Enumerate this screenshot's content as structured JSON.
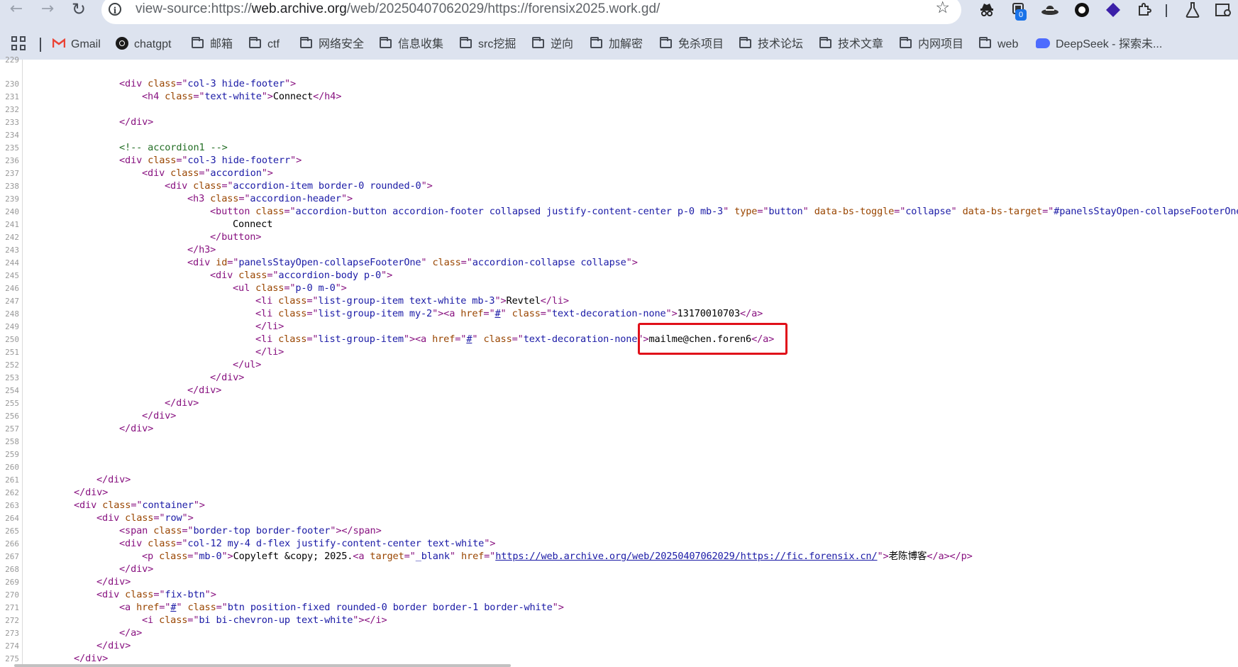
{
  "browser": {
    "url_prefix": "view-source:https://",
    "url_host": "web.archive.org",
    "url_path": "/web/20250407062029/https://forensix2025.work.gd/",
    "extension_badge": "0",
    "bookmarks": [
      "Gmail",
      "chatgpt",
      "邮箱",
      "ctf",
      "网络安全",
      "信息收集",
      "src挖掘",
      "逆向",
      "加解密",
      "免杀项目",
      "技术论坛",
      "技术文章",
      "内网项目",
      "web",
      "DeepSeek - 探索未..."
    ]
  },
  "source": {
    "line_numbers": [
      "229",
      "230",
      "231",
      "232",
      "233",
      "234",
      "235",
      "236",
      "237",
      "238",
      "239",
      "240",
      "241",
      "242",
      "243",
      "244",
      "245",
      "246",
      "247",
      "248",
      "249",
      "250",
      "251",
      "252",
      "253",
      "254",
      "255",
      "256",
      "257",
      "258",
      "259",
      "260",
      "261",
      "262",
      "263",
      "264",
      "265",
      "266",
      "267",
      "268",
      "269",
      "270",
      "271",
      "272",
      "273",
      "274",
      "275"
    ],
    "tokens": {
      "l230": [
        "<div ",
        "class",
        "=\"",
        "col-3 hide-footer",
        "\">"
      ],
      "l231": [
        "<h4 ",
        "class",
        "=\"",
        "text-white",
        "\">",
        "Connect",
        "</h4>"
      ],
      "l233": [
        "</div>"
      ],
      "l235": [
        "<!-- accordion1 -->"
      ],
      "l236": [
        "<div ",
        "class",
        "=\"",
        "col-3 hide-footerr",
        "\">"
      ],
      "l237": [
        "<div ",
        "class",
        "=\"",
        "accordion",
        "\">"
      ],
      "l238": [
        "<div ",
        "class",
        "=\"",
        "accordion-item border-0 rounded-0",
        "\">"
      ],
      "l239": [
        "<h3 ",
        "class",
        "=\"",
        "accordion-header",
        "\">"
      ],
      "l240": [
        "<button ",
        "class",
        "=\"",
        "accordion-button accordion-footer collapsed justify-content-center p-0 mb-3",
        "\" ",
        "type",
        "=\"",
        "button",
        "\" ",
        "data-bs-toggle",
        "=\"",
        "collapse",
        "\" ",
        "data-bs-target",
        "=\"",
        "#panelsStayOpen-collapseFooterOne"
      ],
      "l241": [
        "Connect"
      ],
      "l242": [
        "</button>"
      ],
      "l243": [
        "</h3>"
      ],
      "l244": [
        "<div ",
        "id",
        "=\"",
        "panelsStayOpen-collapseFooterOne",
        "\" ",
        "class",
        "=\"",
        "accordion-collapse collapse",
        "\">"
      ],
      "l245": [
        "<div ",
        "class",
        "=\"",
        "accordion-body p-0",
        "\">"
      ],
      "l246": [
        "<ul ",
        "class",
        "=\"",
        "p-0 m-0",
        "\">"
      ],
      "l247": [
        "<li ",
        "class",
        "=\"",
        "list-group-item text-white mb-3",
        "\">",
        "Revtel",
        "</li>"
      ],
      "l248": [
        "<li ",
        "class",
        "=\"",
        "list-group-item my-2",
        "\">",
        "<a ",
        "href",
        "=\"",
        "#",
        "\" ",
        "class",
        "=\"",
        "text-decoration-none",
        "\">",
        "13170010703",
        "</a>"
      ],
      "l249": [
        "</li>"
      ],
      "l250": [
        "<li ",
        "class",
        "=\"",
        "list-group-item",
        "\">",
        "<a ",
        "href",
        "=\"",
        "#",
        "\" ",
        "class",
        "=\"",
        "text-decoration-none",
        "\">",
        "mailme@chen.foren6",
        "</a>"
      ],
      "l251": [
        "</li>"
      ],
      "l252": [
        "</ul>"
      ],
      "l253": [
        "</div>"
      ],
      "l254": [
        "</div>"
      ],
      "l255": [
        "</div>"
      ],
      "l256": [
        "</div>"
      ],
      "l257": [
        "</div>"
      ],
      "l261": [
        "</div>"
      ],
      "l262": [
        "</div>"
      ],
      "l263": [
        "<div ",
        "class",
        "=\"",
        "container",
        "\">"
      ],
      "l264": [
        "<div ",
        "class",
        "=\"",
        "row",
        "\">"
      ],
      "l265": [
        "<span ",
        "class",
        "=\"",
        "border-top border-footer",
        "\">",
        "</span>"
      ],
      "l266": [
        "<div ",
        "class",
        "=\"",
        "col-12 my-4 d-flex justify-content-center text-white",
        "\">"
      ],
      "l267": [
        "<p ",
        "class",
        "=\"",
        "mb-0",
        "\">",
        "Copyleft &copy; 2025.",
        "<a ",
        "target",
        "=\"",
        "_blank",
        "\" ",
        "href",
        "=\"",
        "https://web.archive.org/web/20250407062029/https://fic.forensix.cn/",
        "\">",
        "老陈博客",
        "</a></p>"
      ],
      "l268": [
        "</div>"
      ],
      "l269": [
        "</div>"
      ],
      "l270": [
        "<div ",
        "class",
        "=\"",
        "fix-btn",
        "\">"
      ],
      "l271": [
        "<a ",
        "href",
        "=\"",
        "#",
        "\" ",
        "class",
        "=\"",
        "btn position-fixed rounded-0 border border-1 border-white",
        "\">"
      ],
      "l272": [
        "<i ",
        "class",
        "=\"",
        "bi bi-chevron-up text-white",
        "\">",
        "</i>"
      ],
      "l273": [
        "</a>"
      ],
      "l274": [
        "</div>"
      ],
      "l275": [
        "</div>"
      ]
    }
  },
  "colors": {
    "tag": "#881280",
    "attribute": "#994500",
    "value": "#1a1aa6",
    "comment": "#236e25",
    "highlight": "#e0101a"
  }
}
